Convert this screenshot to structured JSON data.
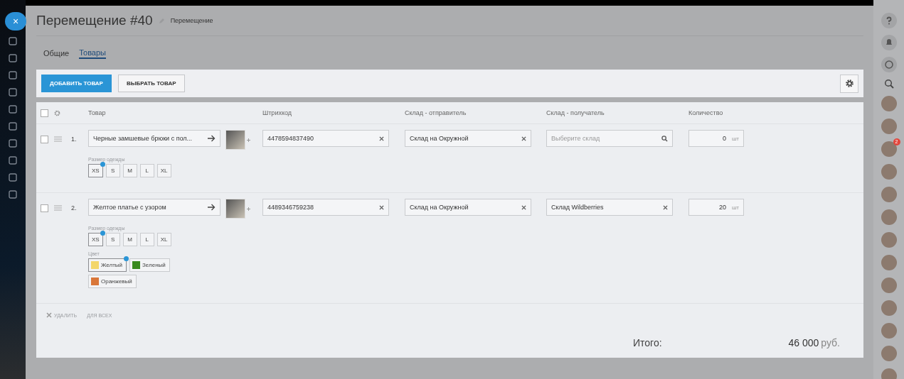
{
  "close_button": "×",
  "title": "Перемещение #40",
  "subtitle": "Перемещение",
  "tabs": [
    {
      "label": "Общие",
      "selected": false
    },
    {
      "label": "Товары",
      "selected": true
    }
  ],
  "toolbar": {
    "buttons": [
      {
        "label": "ДОБАВИТЬ ТОВАР",
        "kind": "primary"
      },
      {
        "label": "ВЫБРАТЬ ТОВАР",
        "kind": "secondary"
      }
    ]
  },
  "table": {
    "all_checked": false,
    "columns": [
      "Товар",
      "Штрихкод",
      "Склад - отправитель",
      "Склад - получатель",
      "Количество"
    ],
    "rows": [
      {
        "checked": false,
        "number": "1.",
        "product": "Черные замшевые брюки с пол...",
        "barcode": "4478594837490",
        "sender": {
          "value": "Склад на Окружной"
        },
        "receiver": {
          "placeholder": "Выберите склад"
        },
        "quantity": "0",
        "unit": "шт",
        "properties": [
          {
            "label": "Размер одежды",
            "kind": "size",
            "options": [
              {
                "label": "XS",
                "selected": true
              },
              {
                "label": "S",
                "selected": false
              },
              {
                "label": "M",
                "selected": false
              },
              {
                "label": "L",
                "selected": false
              },
              {
                "label": "XL",
                "selected": false
              }
            ]
          }
        ]
      },
      {
        "checked": false,
        "number": "2.",
        "product": "Желтое платье с узором",
        "barcode": "4489346759238",
        "sender": {
          "value": "Склад на Окружной"
        },
        "receiver": {
          "value": "Склад Wildberries"
        },
        "quantity": "20",
        "unit": "шт",
        "properties": [
          {
            "label": "Размер одежды",
            "kind": "size",
            "options": [
              {
                "label": "XS",
                "selected": true
              },
              {
                "label": "S",
                "selected": false
              },
              {
                "label": "M",
                "selected": false
              },
              {
                "label": "L",
                "selected": false
              },
              {
                "label": "XL",
                "selected": false
              }
            ]
          },
          {
            "label": "Цвет",
            "kind": "color",
            "options": [
              {
                "label": "Желтый",
                "selected": true,
                "color": "#f3d66a"
              },
              {
                "label": "Зеленый",
                "selected": false,
                "color": "#3a8a1f"
              },
              {
                "label": "Оранжевый",
                "selected": false,
                "color": "#d9773a"
              }
            ]
          }
        ]
      }
    ]
  },
  "footer": {
    "actions": [
      "УДАЛИТЬ",
      "ДЛЯ ВСЕХ"
    ],
    "total_label": "Итого:",
    "total_value": "46 000",
    "currency": "руб."
  },
  "avatars": [
    {
      "kind": "photo"
    },
    {
      "kind": "photo"
    },
    {
      "kind": "photo",
      "badge": "2"
    },
    {
      "kind": "photo"
    },
    {
      "kind": "photo"
    },
    {
      "kind": "photo"
    },
    {
      "kind": "photo"
    },
    {
      "kind": "photo"
    },
    {
      "kind": "photo"
    },
    {
      "kind": "photo"
    },
    {
      "kind": "photo"
    },
    {
      "kind": "photo"
    },
    {
      "kind": "photo"
    }
  ]
}
